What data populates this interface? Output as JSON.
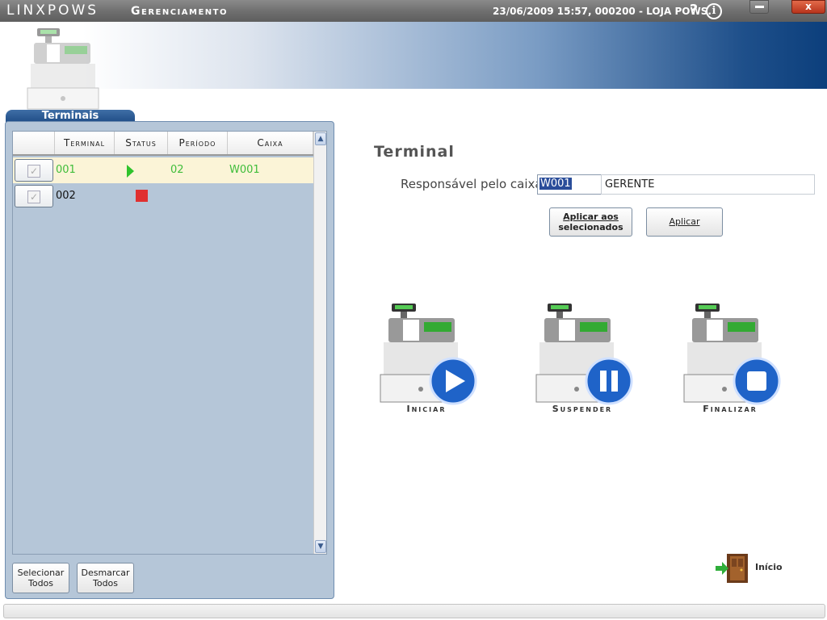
{
  "titlebar": {
    "app_name": "LINXPOWS",
    "module": "Gerenciamento",
    "session": "23/06/2009 15:57, 000200 - LOJA POWS.",
    "help": "?",
    "info": "i",
    "close": "x"
  },
  "left_panel": {
    "tab_label": "Terminais",
    "columns": [
      "Terminal",
      "Status",
      "Período",
      "Caixa"
    ],
    "rows": [
      {
        "check": "✓",
        "terminal": "001",
        "status": "running",
        "periodo": "02",
        "caixa": "W001"
      },
      {
        "check": "✓",
        "terminal": "002",
        "status": "stopped",
        "periodo": "",
        "caixa": ""
      }
    ],
    "scroll_up": "▲",
    "scroll_down": "▼",
    "select_all_line1": "Selecionar",
    "select_all_line2": "Todos",
    "unselect_all_line1": "Desmarcar",
    "unselect_all_line2": "Todos"
  },
  "main": {
    "section_title": "Terminal",
    "responsavel_label": "Responsável pelo caixa",
    "responsavel_code": "W001",
    "responsavel_name": "GERENTE",
    "apply_selected_line1": "Aplicar aos",
    "apply_selected_line2": "selecionados",
    "apply_label": "Aplicar",
    "actions": [
      {
        "label": "Iniciar",
        "icon": "play-icon"
      },
      {
        "label": "Suspender",
        "icon": "pause-icon"
      },
      {
        "label": "Finalizar",
        "icon": "stop-icon"
      }
    ],
    "inicio_label": "Início"
  },
  "colors": {
    "accent": "#0c3f7c",
    "running": "#2fc32c",
    "stopped": "#e03030",
    "panel": "#b5c6d8"
  }
}
